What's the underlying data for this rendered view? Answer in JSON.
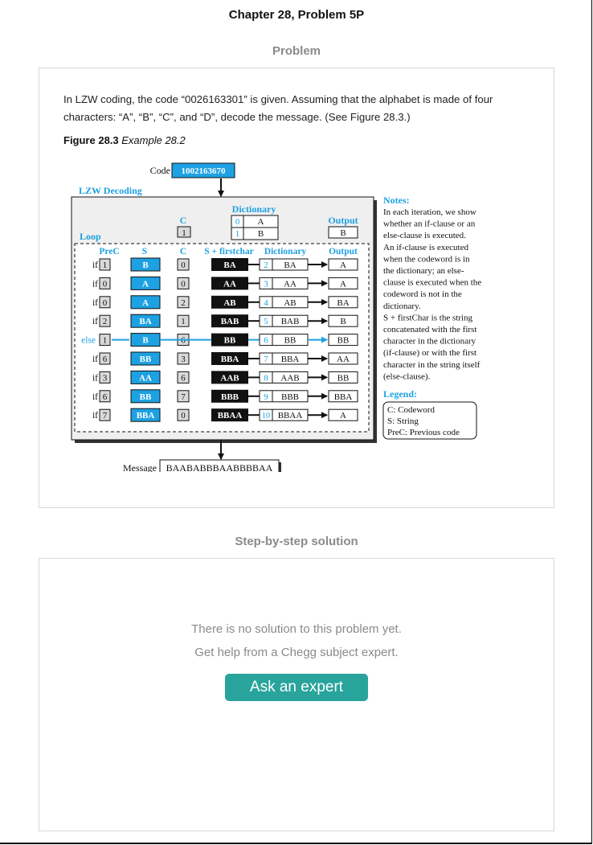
{
  "page": {
    "chapter_title": "Chapter 28, Problem 5P",
    "problem_heading": "Problem",
    "solution_heading": "Step-by-step solution"
  },
  "problem": {
    "line1": "In LZW coding, the code “0026163301” is given. Assuming that the alphabet is made of four",
    "line2": "characters: “A”, “B”, “C”, and “D”, decode the message. (See Figure 28.3.)",
    "figure_label": "Figure 28.3",
    "figure_caption": "Example 28.2"
  },
  "figure": {
    "code_label": "Code",
    "code_value": "1002163670",
    "title": "LZW Decoding",
    "loop_label": "Loop",
    "init_c_header": "C",
    "init_c_value": "1",
    "dictionary_header": "Dictionary",
    "init_dictionary": [
      {
        "code": "0",
        "string": "A"
      },
      {
        "code": "1",
        "string": "B"
      }
    ],
    "init_output_header": "Output",
    "init_output": "B",
    "column_headers": {
      "prec": "PreC",
      "s": "S",
      "c": "C",
      "s_firstchar": "S + firstchar",
      "dictionary": "Dictionary",
      "output": "Output"
    },
    "rows": [
      {
        "clause": "if",
        "prec": "1",
        "s": "B",
        "c": "0",
        "sfc": "BA",
        "dict_code": "2",
        "dict_str": "BA",
        "output": "A"
      },
      {
        "clause": "if",
        "prec": "0",
        "s": "A",
        "c": "0",
        "sfc": "AA",
        "dict_code": "3",
        "dict_str": "AA",
        "output": "A"
      },
      {
        "clause": "if",
        "prec": "0",
        "s": "A",
        "c": "2",
        "sfc": "AB",
        "dict_code": "4",
        "dict_str": "AB",
        "output": "BA"
      },
      {
        "clause": "if",
        "prec": "2",
        "s": "BA",
        "c": "1",
        "sfc": "BAB",
        "dict_code": "5",
        "dict_str": "BAB",
        "output": "B"
      },
      {
        "clause": "else",
        "prec": "1",
        "s": "B",
        "c": "6",
        "sfc": "BB",
        "dict_code": "6",
        "dict_str": "BB",
        "output": "BB"
      },
      {
        "clause": "if",
        "prec": "6",
        "s": "BB",
        "c": "3",
        "sfc": "BBA",
        "dict_code": "7",
        "dict_str": "BBA",
        "output": "AA"
      },
      {
        "clause": "if",
        "prec": "3",
        "s": "AA",
        "c": "6",
        "sfc": "AAB",
        "dict_code": "8",
        "dict_str": "AAB",
        "output": "BB"
      },
      {
        "clause": "if",
        "prec": "6",
        "s": "BB",
        "c": "7",
        "sfc": "BBB",
        "dict_code": "9",
        "dict_str": "BBB",
        "output": "BBA"
      },
      {
        "clause": "if",
        "prec": "7",
        "s": "BBA",
        "c": "0",
        "sfc": "BBAA",
        "dict_code": "10",
        "dict_str": "BBAA",
        "output": "A"
      }
    ],
    "message_label": "Message",
    "message_value": "BAABABBBAABBBBAA",
    "notes_title": "Notes:",
    "notes_lines": [
      "In each iteration, we show",
      "whether an if-clause or an",
      "else-clause is executed.",
      "An if-clause is executed",
      "when the codeword is in",
      "the dictionary; an else-",
      "clause is executed when the",
      "codeword is not in the",
      "dictionary.",
      "S + firstChar is the string",
      "concatenated with the first",
      "character in the dictionary",
      "(if-clause) or with the first",
      "character in the string itself",
      "(else-clause)."
    ],
    "legend_title": "Legend:",
    "legend_lines": [
      "C: Codeword",
      "S: String",
      "PreC: Previous code"
    ],
    "colors": {
      "accent_blue": "#1da1e2",
      "grey_fill": "#d9d9d9",
      "dark_fill": "#111111"
    }
  },
  "solution": {
    "message1": "There is no solution to this problem yet.",
    "message2": "Get help from a Chegg subject expert.",
    "button_label": "Ask an expert"
  }
}
